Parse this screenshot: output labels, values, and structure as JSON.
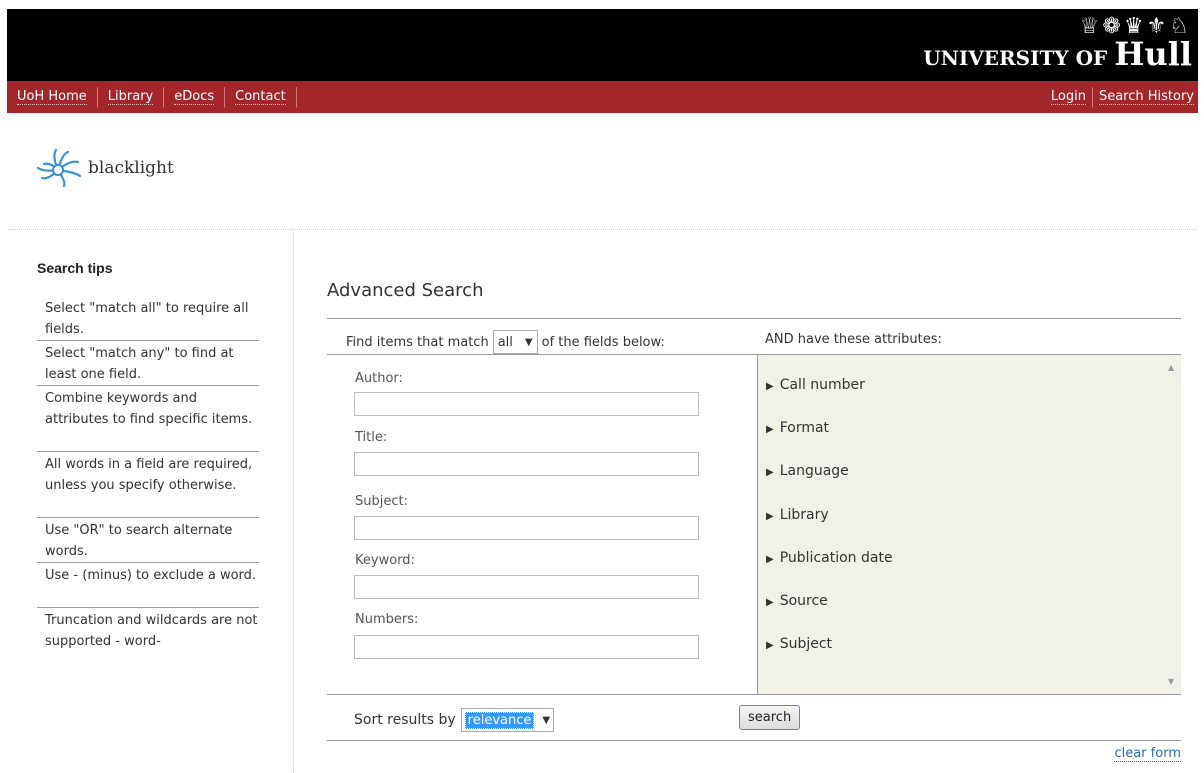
{
  "header": {
    "university_crests": "♕❁♛⚜♘",
    "university_name_prefix": "UNIVERSITY OF",
    "university_name_main": "Hull",
    "logo_text": "blacklight"
  },
  "nav": {
    "left": [
      "UoH Home",
      "Library",
      "eDocs",
      "Contact"
    ],
    "right": [
      "Login",
      "Search History"
    ]
  },
  "sidebar": {
    "title": "Search tips",
    "tips": [
      "Select \"match all\" to require all fields.",
      "Select \"match any\" to find at least one field.",
      "Combine keywords and attributes to find specific items.",
      "All words in a field are required, unless you specify otherwise.",
      "Use \"OR\" to search alternate words.",
      "Use - (minus) to exclude a word.",
      "Truncation and wildcards are not supported - word-"
    ]
  },
  "advanced": {
    "title": "Advanced Search",
    "match_prefix": "Find items that match",
    "match_value": "all",
    "match_suffix": "of the fields below:",
    "attributes_heading": "AND have these attributes:",
    "fields": [
      {
        "label": "Author:",
        "value": ""
      },
      {
        "label": "Title:",
        "value": ""
      },
      {
        "label": "Subject:",
        "value": ""
      },
      {
        "label": "Keyword:",
        "value": ""
      },
      {
        "label": "Numbers:",
        "value": ""
      }
    ],
    "attributes": [
      "Call number",
      "Format",
      "Language",
      "Library",
      "Publication date",
      "Source",
      "Subject"
    ],
    "sort_label": "Sort results by",
    "sort_value": "relevance",
    "search_button": "search",
    "clear_form": "clear form"
  }
}
